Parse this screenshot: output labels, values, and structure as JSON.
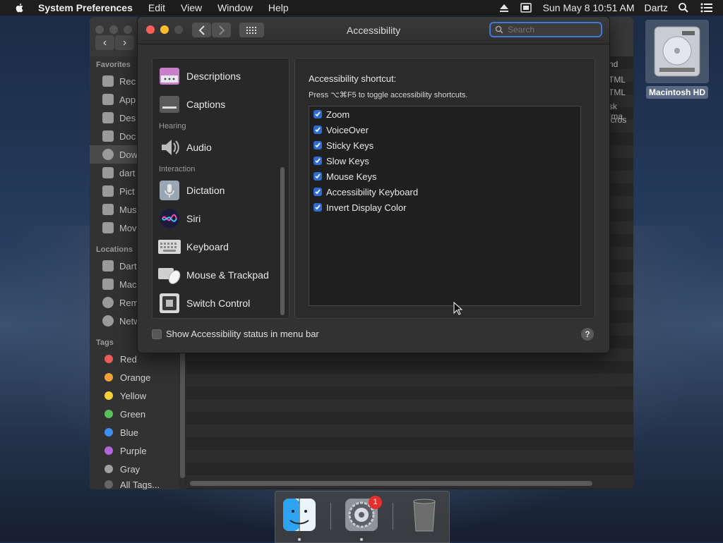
{
  "menubar": {
    "app_name": "System Preferences",
    "items": [
      "Edit",
      "View",
      "Window",
      "Help"
    ],
    "clock": "Sun May 8  10:51 AM",
    "user": "Dartz"
  },
  "desktop": {
    "drive_label": "Macintosh HD"
  },
  "finder": {
    "favorites_header": "Favorites",
    "favorites": [
      "Rec",
      "App",
      "Des",
      "Doc",
      "Dow",
      "dart",
      "Pict",
      "Mus",
      "Mov"
    ],
    "locations_header": "Locations",
    "locations": [
      "Dart",
      "Mac",
      "Rem",
      "Netw"
    ],
    "tags_header": "Tags",
    "tags": [
      {
        "name": "Red",
        "color": "#ec5b57"
      },
      {
        "name": "Orange",
        "color": "#f3a13b"
      },
      {
        "name": "Yellow",
        "color": "#f4d03a"
      },
      {
        "name": "Green",
        "color": "#5ac05a"
      },
      {
        "name": "Blue",
        "color": "#3d8ef1"
      },
      {
        "name": "Purple",
        "color": "#b065d8"
      },
      {
        "name": "Gray",
        "color": "#a0a0a0"
      }
    ],
    "all_tags": "All Tags...",
    "kind_header": "nd",
    "kind_values": [
      "TML",
      "TML",
      "sk Ima",
      "icros"
    ]
  },
  "prefs": {
    "title": "Accessibility",
    "search_placeholder": "Search",
    "list": {
      "descriptions": "Descriptions",
      "captions": "Captions",
      "hearing_header": "Hearing",
      "audio": "Audio",
      "interaction_header": "Interaction",
      "dictation": "Dictation",
      "siri": "Siri",
      "keyboard": "Keyboard",
      "mouse": "Mouse & Trackpad",
      "switch": "Switch Control"
    },
    "shortcut_title": "Accessibility shortcut:",
    "shortcut_sub": "Press ⌥⌘F5 to toggle accessibility shortcuts.",
    "options": [
      "Zoom",
      "VoiceOver",
      "Sticky Keys",
      "Slow Keys",
      "Mouse Keys",
      "Accessibility Keyboard",
      "Invert Display Color"
    ],
    "status_label": "Show Accessibility status in menu bar",
    "help": "?"
  },
  "dock": {
    "prefs_badge": "1"
  }
}
